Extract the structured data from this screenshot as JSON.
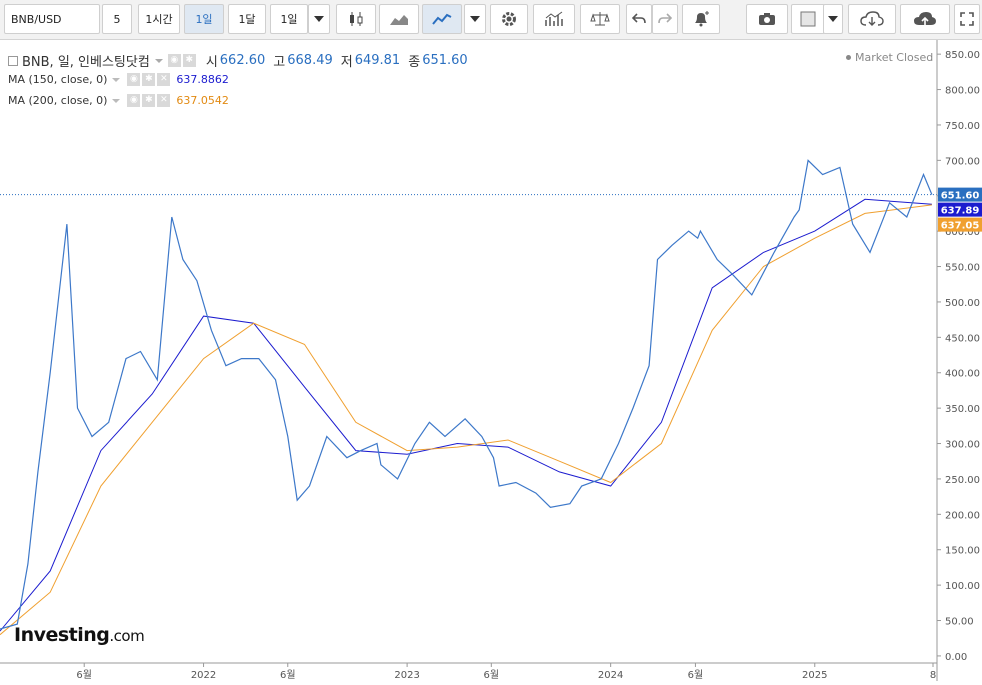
{
  "toolbar": {
    "symbol": "BNB/USD",
    "interval_5": "5",
    "interval_1h": "1시간",
    "interval_1d": "1일",
    "interval_1m": "1달",
    "interval_1y": "1일"
  },
  "legend": {
    "title": "BNB, 일, 인베스팅닷컴",
    "open_label": "시",
    "open": "662.60",
    "high_label": "고",
    "high": "668.49",
    "low_label": "저",
    "low": "649.81",
    "close_label": "종",
    "close": "651.60",
    "ma150_label": "MA (150, close, 0)",
    "ma150_value": "637.8862",
    "ma200_label": "MA (200, close, 0)",
    "ma200_value": "637.0542",
    "market_status": "Market Closed"
  },
  "logo": {
    "brand": "Investing",
    "suffix": ".com"
  },
  "colors": {
    "price": "#3d78c9",
    "ma150": "#1c1ccf",
    "ma200": "#f0a030",
    "last_price_tag": "#2a6fc0"
  },
  "chart_data": {
    "type": "line",
    "title": "BNB/USD",
    "ylim": [
      -10,
      870
    ],
    "y_ticks": [
      0,
      50,
      100,
      150,
      200,
      250,
      300,
      350,
      400,
      450,
      500,
      550,
      600,
      650,
      700,
      750,
      800,
      850
    ],
    "y_tick_labels": [
      "0.00",
      "50.00",
      "100.00",
      "150.00",
      "200.00",
      "250.00",
      "300.00",
      "350.00",
      "400.00",
      "450.00",
      "500.00",
      "550.00",
      "600.00",
      "650.00",
      "700.00",
      "750.00",
      "800.00",
      "850.00"
    ],
    "x_tick_labels": [
      "6월",
      "2022",
      "6월",
      "2023",
      "6월",
      "2024",
      "6월",
      "2025",
      "8"
    ],
    "x_tick_dates": [
      "2021-06-01",
      "2022-01-01",
      "2022-06-01",
      "2023-01-01",
      "2023-06-01",
      "2024-01-01",
      "2024-06-01",
      "2025-01-01",
      "2025-08-01"
    ],
    "x_range": [
      "2021-01-01",
      "2025-08-01"
    ],
    "series": [
      {
        "name": "BNB/USD",
        "x": [
          "2021-01-01",
          "2021-02-01",
          "2021-02-20",
          "2021-03-10",
          "2021-04-01",
          "2021-05-01",
          "2021-05-20",
          "2021-06-15",
          "2021-07-15",
          "2021-08-15",
          "2021-09-10",
          "2021-10-10",
          "2021-11-05",
          "2021-11-25",
          "2021-12-20",
          "2022-01-15",
          "2022-02-10",
          "2022-03-10",
          "2022-04-10",
          "2022-05-10",
          "2022-06-01",
          "2022-06-18",
          "2022-07-10",
          "2022-08-10",
          "2022-09-15",
          "2022-10-10",
          "2022-11-08",
          "2022-11-15",
          "2022-12-15",
          "2023-01-15",
          "2023-02-10",
          "2023-03-10",
          "2023-04-15",
          "2023-05-15",
          "2023-06-05",
          "2023-06-15",
          "2023-07-15",
          "2023-08-20",
          "2023-09-15",
          "2023-10-20",
          "2023-11-10",
          "2023-12-15",
          "2024-01-15",
          "2024-02-10",
          "2024-03-10",
          "2024-03-25",
          "2024-04-20",
          "2024-05-20",
          "2024-06-05",
          "2024-06-10",
          "2024-07-10",
          "2024-08-05",
          "2024-09-10",
          "2024-10-20",
          "2024-11-25",
          "2024-12-04",
          "2024-12-20",
          "2025-01-15",
          "2025-02-15",
          "2025-03-10",
          "2025-04-10",
          "2025-05-15",
          "2025-06-15",
          "2025-07-15",
          "2025-07-30"
        ],
        "y": [
          38,
          45,
          130,
          260,
          400,
          610,
          350,
          310,
          330,
          420,
          430,
          390,
          620,
          560,
          530,
          460,
          410,
          420,
          420,
          390,
          310,
          220,
          240,
          310,
          280,
          290,
          300,
          270,
          250,
          300,
          330,
          310,
          335,
          310,
          280,
          240,
          245,
          230,
          210,
          215,
          240,
          250,
          300,
          350,
          410,
          560,
          580,
          600,
          590,
          600,
          560,
          540,
          510,
          570,
          620,
          630,
          700,
          680,
          690,
          610,
          570,
          640,
          620,
          680,
          651.6
        ]
      },
      {
        "name": "MA (150, close, 0)",
        "x": [
          "2021-01-01",
          "2021-04-01",
          "2021-07-01",
          "2021-10-01",
          "2022-01-01",
          "2022-04-01",
          "2022-07-01",
          "2022-10-01",
          "2023-01-01",
          "2023-04-01",
          "2023-07-01",
          "2023-10-01",
          "2024-01-01",
          "2024-04-01",
          "2024-07-01",
          "2024-10-01",
          "2025-01-01",
          "2025-04-01",
          "2025-07-30"
        ],
        "y": [
          35,
          120,
          290,
          370,
          480,
          470,
          380,
          290,
          285,
          300,
          295,
          260,
          240,
          330,
          520,
          570,
          600,
          645,
          637.89
        ]
      },
      {
        "name": "MA (200, close, 0)",
        "x": [
          "2021-01-01",
          "2021-04-01",
          "2021-07-01",
          "2021-10-01",
          "2022-01-01",
          "2022-04-01",
          "2022-07-01",
          "2022-10-01",
          "2023-01-01",
          "2023-04-01",
          "2023-07-01",
          "2023-10-01",
          "2024-01-01",
          "2024-04-01",
          "2024-07-01",
          "2024-10-01",
          "2025-01-01",
          "2025-04-01",
          "2025-07-30"
        ],
        "y": [
          30,
          90,
          240,
          330,
          420,
          470,
          440,
          330,
          290,
          295,
          305,
          275,
          245,
          300,
          460,
          550,
          590,
          625,
          637.05
        ]
      }
    ]
  }
}
